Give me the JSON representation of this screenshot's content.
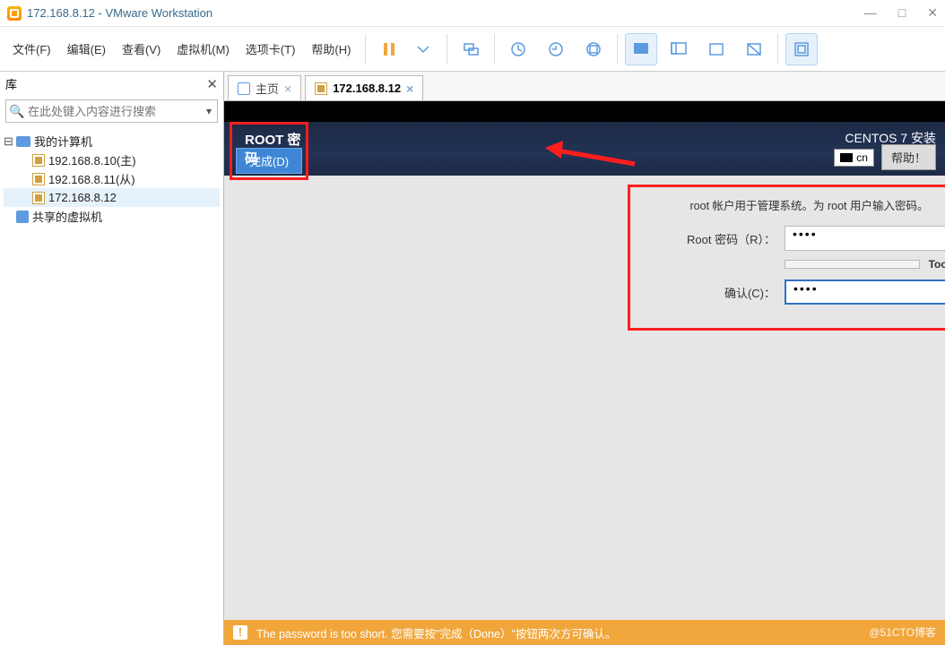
{
  "titlebar": {
    "title": "172.168.8.12 - VMware Workstation"
  },
  "menu": {
    "file": "文件(F)",
    "edit": "编辑(E)",
    "view": "查看(V)",
    "vm": "虚拟机(M)",
    "tabs": "选项卡(T)",
    "help": "帮助(H)"
  },
  "sidebar": {
    "title": "库",
    "search_placeholder": "在此处键入内容进行搜索",
    "root": "我的计算机",
    "vms": [
      "192.168.8.10(主)",
      "192.168.8.11(从)",
      "172.168.8.12"
    ],
    "shared": "共享的虚拟机"
  },
  "tabs": {
    "home": "主页",
    "active": "172.168.8.12"
  },
  "installer": {
    "heading": "ROOT 密码",
    "done": "完成(D)",
    "product": "CENTOS 7 安装",
    "lang": "cn",
    "help": "帮助！",
    "description": "root 帐户用于管理系统。为 root 用户输入密码。",
    "pw_label": "Root 密码（R）：",
    "confirm_label": "确认(C)：",
    "pw_value": "••••",
    "confirm_value": "••••",
    "strength": "Too short",
    "warning": "The password is too short. 您需要按\"完成（Done）\"按钮两次方可确认。",
    "watermark": "@51CTO博客"
  }
}
